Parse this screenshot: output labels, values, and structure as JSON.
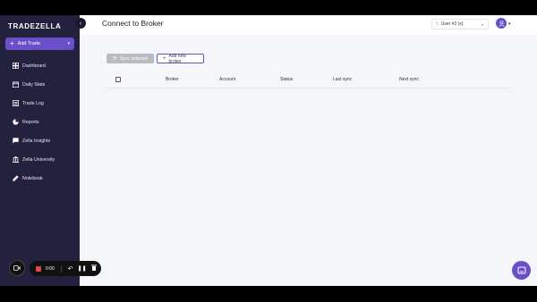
{
  "app": {
    "logo_text": "TRADEZELLA"
  },
  "sidebar": {
    "add_trade_label": "Add Trade",
    "items": [
      {
        "label": "Dashboard",
        "icon": "dashboard-icon"
      },
      {
        "label": "Daily Stats",
        "icon": "calendar-icon"
      },
      {
        "label": "Trade Log",
        "icon": "list-icon"
      },
      {
        "label": "Reports",
        "icon": "pie-chart-icon"
      },
      {
        "label": "Zella Insights",
        "icon": "chat-bubble-icon"
      },
      {
        "label": "Zella University",
        "icon": "university-icon"
      },
      {
        "label": "Notebook",
        "icon": "pen-icon"
      }
    ]
  },
  "recorder": {
    "time": "0:00"
  },
  "header": {
    "title": "Connect to Broker",
    "user_select": "User #2 (x)"
  },
  "toolbar": {
    "sync_label": "Sync selected",
    "add_label": "Add new broker"
  },
  "table": {
    "columns": [
      "Broker",
      "Account",
      "Status",
      "Last sync",
      "Next sync"
    ]
  },
  "colors": {
    "accent": "#6b4fc8",
    "sidebar_bg": "#24213f",
    "page_bg": "#f5f6f9"
  }
}
